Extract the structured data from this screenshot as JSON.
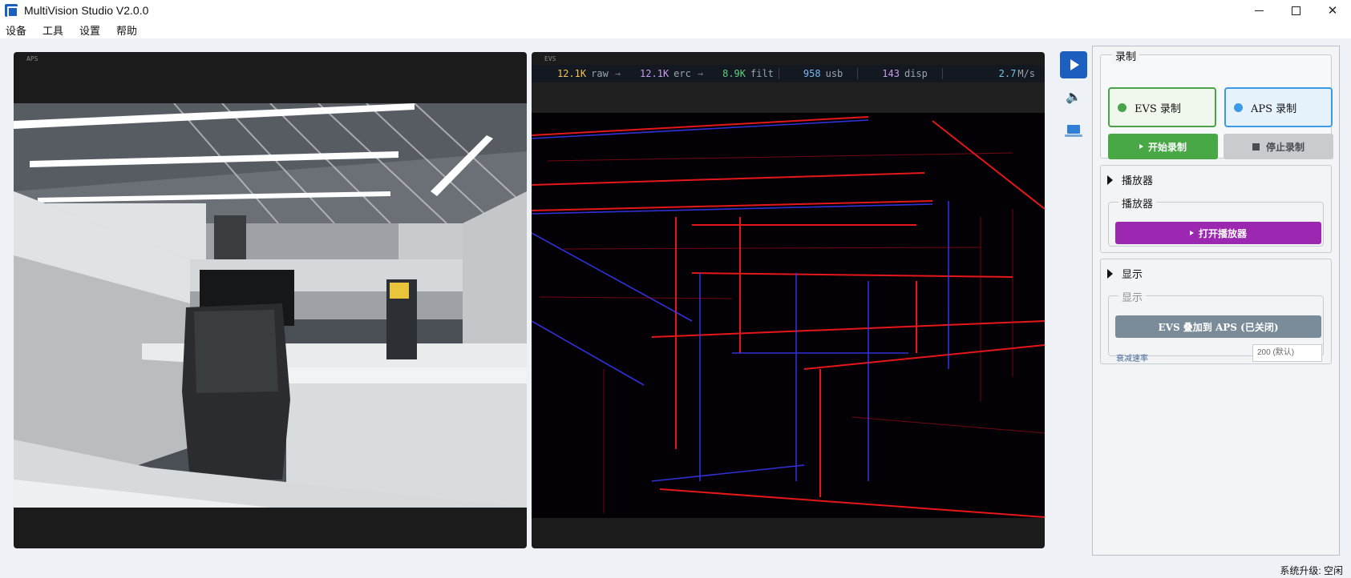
{
  "window": {
    "title": "MultiVision Studio V2.0.0",
    "minimize_icon": "minimize-icon",
    "maximize_icon": "maximize-icon",
    "close_glyph": "✕"
  },
  "menu": [
    "设备",
    "工具",
    "设置",
    "帮助"
  ],
  "aps": {
    "label": "APS"
  },
  "evs": {
    "label": "EVS",
    "stats": [
      {
        "value": "12.1K",
        "unit": "raw",
        "color": "#f5c451",
        "arrow": "→"
      },
      {
        "value": "12.1K",
        "unit": "erc",
        "color": "#c69cf0",
        "arrow": "→"
      },
      {
        "value": "8.9K",
        "unit": "filt",
        "color": "#5ed07c",
        "arrow": ""
      },
      {
        "value": "958",
        "unit": "usb",
        "color": "#7ab8f5",
        "arrow": ""
      },
      {
        "value": "143",
        "unit": "disp",
        "color": "#c69cf0",
        "arrow": ""
      },
      {
        "value": "2.7",
        "unit": "M/s",
        "color": "#6fc7e8",
        "arrow": ""
      }
    ]
  },
  "toolbar": {
    "play_icon": "play-icon",
    "speaker_icon": "speaker-icon",
    "laptop_icon": "laptop-icon"
  },
  "record": {
    "group_title": "录制",
    "evs_toggle": "EVS 录制",
    "aps_toggle": "APS 录制",
    "evs_dot_color": "#49a349",
    "aps_dot_color": "#3a9ae6",
    "start_label": "开始录制",
    "stop_label": "停止录制"
  },
  "player": {
    "header": "播放器",
    "inner_title": "播放器",
    "open_label": "打开播放器"
  },
  "display": {
    "header": "显示",
    "inner_title": "显示",
    "overlay_label": "EVS 叠加到 APS (已关闭)",
    "decay_label": "衰减速率",
    "decay_placeholder": "200 (默认)"
  },
  "status": {
    "text": "系统升级: 空闲"
  },
  "colors": {
    "accent": "#1d5fbf",
    "record_green": "#47a845",
    "player_purple": "#9c27b0",
    "overlay_gray": "#7a8b99",
    "evs_on": "#ff1a1a",
    "evs_off": "#3a3aff"
  }
}
